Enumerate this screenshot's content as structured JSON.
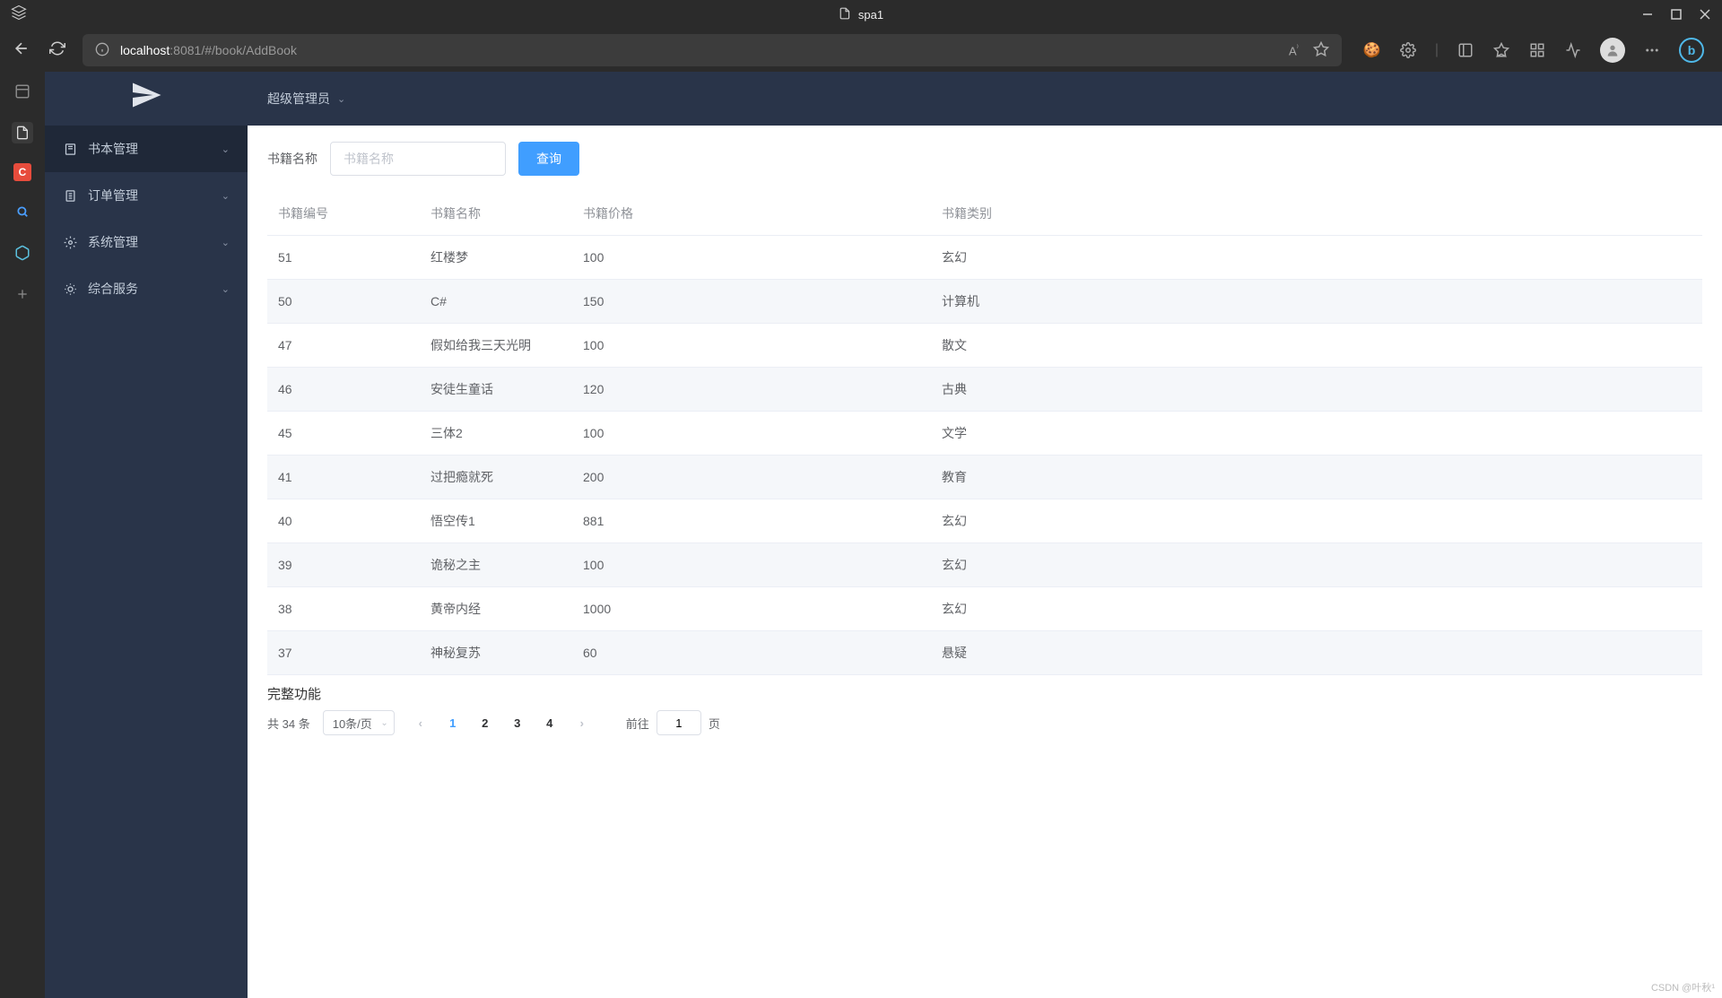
{
  "browser": {
    "tab_title": "spa1",
    "url_host": "localhost",
    "url_port": ":8081",
    "url_path": "/#/book/AddBook",
    "bing_letter": "b"
  },
  "activity": {
    "c_label": "C"
  },
  "sidebar": {
    "items": [
      {
        "label": "书本管理"
      },
      {
        "label": "订单管理"
      },
      {
        "label": "系统管理"
      },
      {
        "label": "综合服务"
      }
    ]
  },
  "header": {
    "user_role": "超级管理员"
  },
  "search": {
    "label": "书籍名称",
    "placeholder": "书籍名称",
    "button": "查询"
  },
  "table": {
    "headers": [
      "书籍编号",
      "书籍名称",
      "书籍价格",
      "书籍类别"
    ],
    "rows": [
      {
        "id": "51",
        "name": "红楼梦",
        "price": "100",
        "category": "玄幻"
      },
      {
        "id": "50",
        "name": "C#",
        "price": "150",
        "category": "计算机"
      },
      {
        "id": "47",
        "name": "假如给我三天光明",
        "price": "100",
        "category": "散文"
      },
      {
        "id": "46",
        "name": "安徒生童话",
        "price": "120",
        "category": "古典"
      },
      {
        "id": "45",
        "name": "三体2",
        "price": "100",
        "category": "文学"
      },
      {
        "id": "41",
        "name": "过把瘾就死",
        "price": "200",
        "category": "教育"
      },
      {
        "id": "40",
        "name": "悟空传1",
        "price": "881",
        "category": "玄幻"
      },
      {
        "id": "39",
        "name": "诡秘之主",
        "price": "100",
        "category": "玄幻"
      },
      {
        "id": "38",
        "name": "黄帝内经",
        "price": "1000",
        "category": "玄幻"
      },
      {
        "id": "37",
        "name": "神秘复苏",
        "price": "60",
        "category": "悬疑"
      }
    ]
  },
  "footer": {
    "title": "完整功能",
    "total_prefix": "共 ",
    "total_count": "34",
    "total_suffix": " 条",
    "page_size": "10条/页",
    "pages": [
      "1",
      "2",
      "3",
      "4"
    ],
    "current_page": "1",
    "jumper_prefix": "前往",
    "jumper_value": "1",
    "jumper_suffix": "页"
  },
  "watermark": "CSDN @叶秋¹"
}
